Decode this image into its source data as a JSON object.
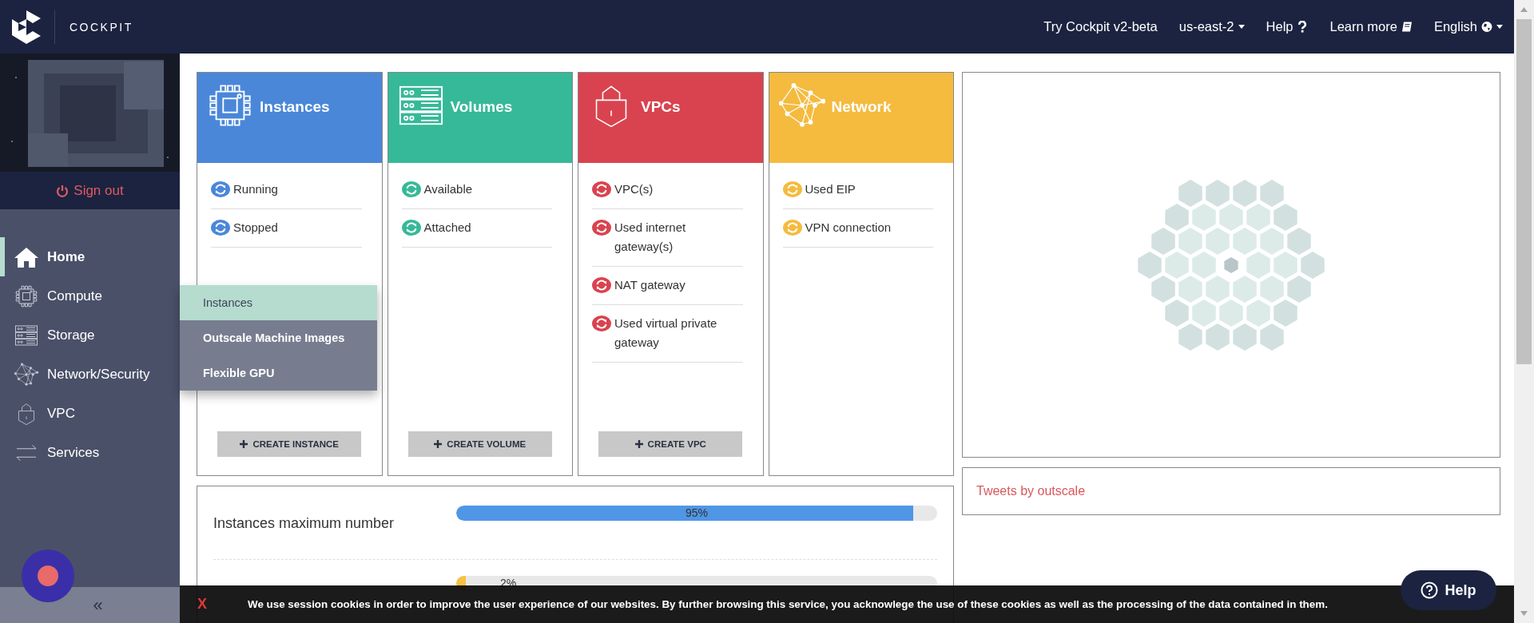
{
  "header": {
    "logo_text": "COCKPIT",
    "links": [
      {
        "label": "Try Cockpit v2-beta",
        "kind": "link"
      },
      {
        "label": "us-east-2",
        "kind": "dropdown"
      },
      {
        "label": "Help",
        "kind": "help"
      },
      {
        "label": "Learn more",
        "kind": "docs"
      },
      {
        "label": "English",
        "kind": "language"
      }
    ]
  },
  "sidebar": {
    "sign_out": "Sign out",
    "collapse": "«",
    "items": [
      {
        "label": "Home",
        "kind": "home",
        "selected": true
      },
      {
        "label": "Compute",
        "kind": "compute",
        "selected": false
      },
      {
        "label": "Storage",
        "kind": "storage",
        "selected": false
      },
      {
        "label": "Network/Security",
        "kind": "network",
        "selected": false
      },
      {
        "label": "VPC",
        "kind": "vpc",
        "selected": false
      },
      {
        "label": "Services",
        "kind": "services",
        "selected": false
      }
    ]
  },
  "submenu": {
    "items": [
      {
        "label": "Instances",
        "selected": true
      },
      {
        "label": "Outscale Machine Images",
        "selected": false
      },
      {
        "label": "Flexible GPU",
        "selected": false
      }
    ]
  },
  "cards": [
    {
      "title": "Instances",
      "kind": "compute",
      "color": "#4a87d9",
      "items": [
        "Running",
        "Stopped"
      ],
      "button": "CREATE INSTANCE"
    },
    {
      "title": "Volumes",
      "kind": "storage",
      "color": "#36b999",
      "items": [
        "Available",
        "Attached"
      ],
      "button": "CREATE VOLUME"
    },
    {
      "title": "VPCs",
      "kind": "vpc",
      "color": "#d9434f",
      "items": [
        "VPC(s)",
        "Used internet gateway(s)",
        "NAT gateway",
        "Used virtual private gateway"
      ],
      "button": "CREATE VPC"
    },
    {
      "title": "Network",
      "kind": "network",
      "color": "#f4bb3f",
      "items": [
        "Used EIP",
        "VPN connection"
      ]
    }
  ],
  "quotas": [
    {
      "label": "Instances maximum number",
      "reading": "95%",
      "level": 0.95,
      "color": "#5096e6"
    },
    {
      "reading": "2%",
      "level": 0.02,
      "color": "#f5c242"
    }
  ],
  "tweets": {
    "label": "Tweets by outscale"
  },
  "cookie_banner": {
    "close": "X",
    "text": "We use session cookies in order to improve the user experience of our websites. By further browsing this service, you acknowlege the use of these cookies as well as the processing of the data contained in them."
  },
  "help_button": {
    "label": "Help"
  }
}
